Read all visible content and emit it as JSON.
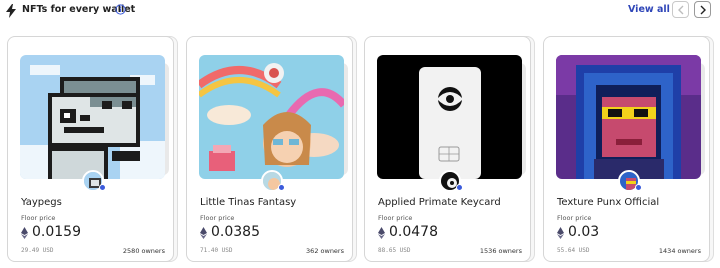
{
  "header": {
    "title": "NFTs for every wallet",
    "view_all": "View all"
  },
  "colors": {
    "accent": "#2f46b8",
    "badge": "#3b5bdb"
  },
  "cards": [
    {
      "name": "Yaypegs",
      "floor_label": "Floor price",
      "price": "0.0159",
      "usd": "29.49 USD",
      "owners": "2580 owners"
    },
    {
      "name": "Little Tinas Fantasy",
      "floor_label": "Floor price",
      "price": "0.0385",
      "usd": "71.40 USD",
      "owners": "362 owners"
    },
    {
      "name": "Applied Primate Keycard",
      "floor_label": "Floor price",
      "price": "0.0478",
      "usd": "88.65 USD",
      "owners": "1536 owners"
    },
    {
      "name": "Texture Punx Official",
      "floor_label": "Floor price",
      "price": "0.03",
      "usd": "55.64 USD",
      "owners": "1434 owners"
    }
  ]
}
